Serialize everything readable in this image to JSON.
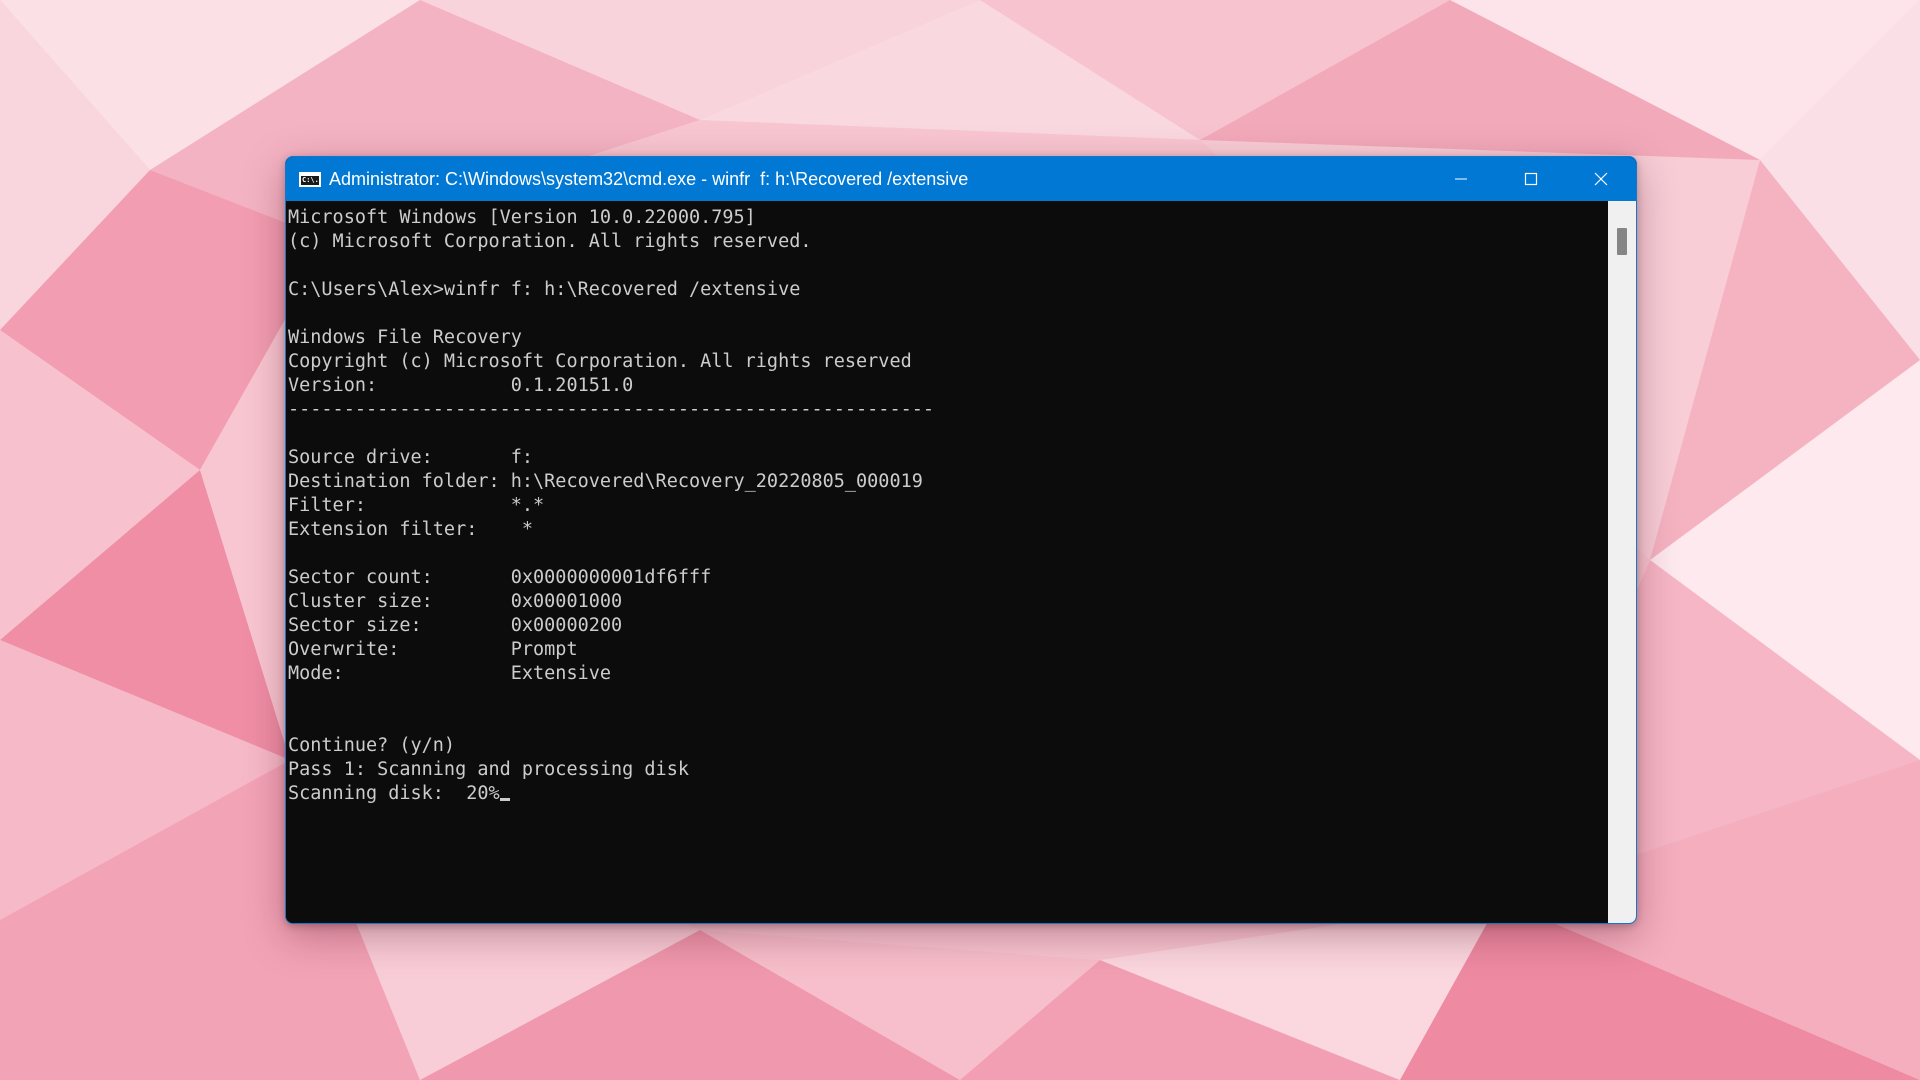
{
  "window": {
    "title": "Administrator: C:\\Windows\\system32\\cmd.exe - winfr  f: h:\\Recovered /extensive",
    "icon": "cmd-icon",
    "icon_label": "C:\\.",
    "controls": {
      "minimize": "minimize-icon",
      "maximize": "maximize-icon",
      "close": "close-icon"
    }
  },
  "console": {
    "lines": [
      "Microsoft Windows [Version 10.0.22000.795]",
      "(c) Microsoft Corporation. All rights reserved.",
      "",
      "C:\\Users\\Alex>winfr f: h:\\Recovered /extensive",
      "",
      "Windows File Recovery",
      "Copyright (c) Microsoft Corporation. All rights reserved",
      "Version:            0.1.20151.0",
      "----------------------------------------------------------",
      "",
      "Source drive:       f:",
      "Destination folder: h:\\Recovered\\Recovery_20220805_000019",
      "Filter:             *.*",
      "Extension filter:    *",
      "",
      "Sector count:       0x0000000001df6fff",
      "Cluster size:       0x00001000",
      "Sector size:        0x00000200",
      "Overwrite:          Prompt",
      "Mode:               Extensive",
      "",
      "",
      "Continue? (y/n)",
      "Pass 1: Scanning and processing disk",
      "Scanning disk:  20%"
    ]
  },
  "colors": {
    "titlebar": "#0078d4",
    "console_bg": "#0c0c0c",
    "console_fg": "#cccccc"
  }
}
